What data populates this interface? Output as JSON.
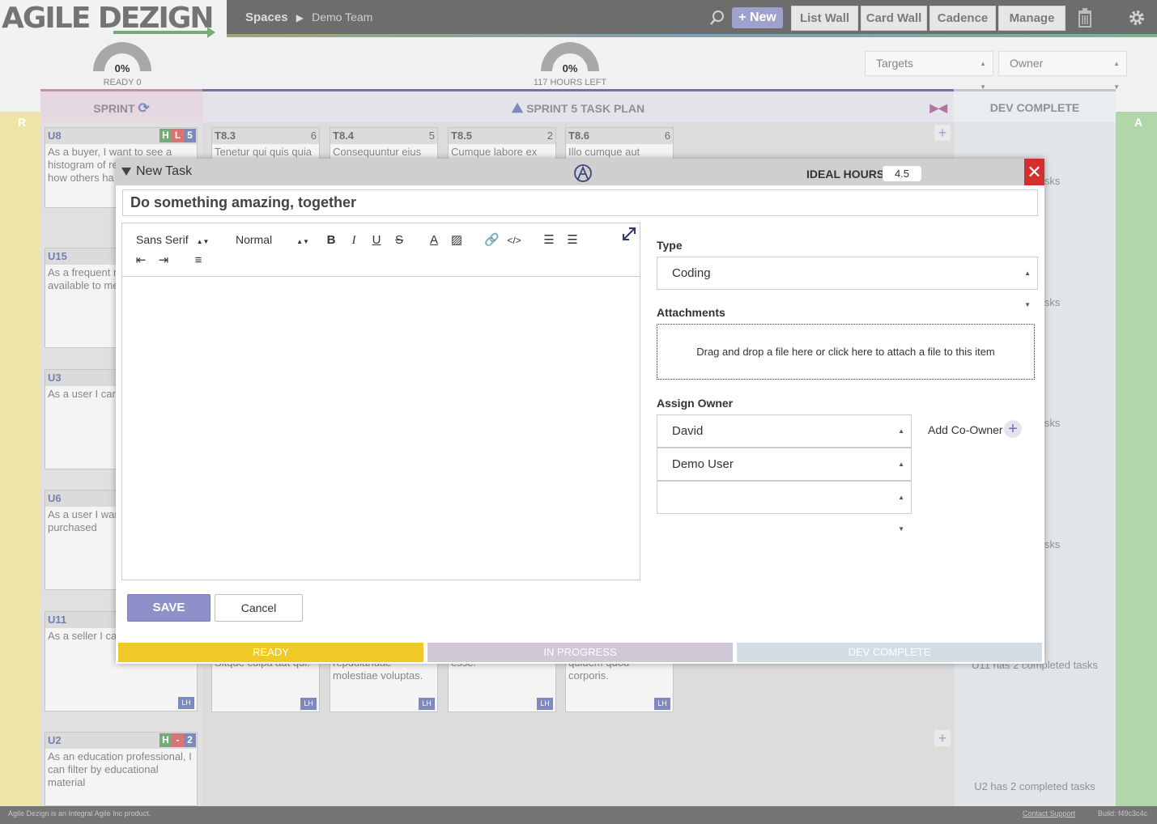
{
  "app": {
    "logo_text": "AGILE DEZIGN",
    "breadcrumb": {
      "root": "Spaces",
      "separator": "▶",
      "current": "Demo Team"
    },
    "new_button": "+ New",
    "nav": [
      "List Wall",
      "Card Wall",
      "Cadence",
      "Manage"
    ]
  },
  "gauges": [
    {
      "pct": "0%",
      "label": "READY 0"
    },
    {
      "pct": "0%",
      "label": "117 HOURS LEFT"
    }
  ],
  "filters": {
    "targets": "Targets",
    "owner": "Owner"
  },
  "columns": {
    "sprint": "SPRINT",
    "task_plan": "SPRINT 5 TASK PLAN",
    "dev_complete": "DEV COMPLETE",
    "left_lane": "R",
    "right_lane": "A"
  },
  "stories": [
    {
      "id": "U8",
      "text": "As a buyer, I want to see a histogram of re and rating so I how others ha am considering",
      "b1": "H",
      "b2": "L",
      "b3": "5"
    },
    {
      "id": "U15",
      "text": "As a frequent my recent sear available to me examples of si"
    },
    {
      "id": "U3",
      "text": "As a user I can results by mult"
    },
    {
      "id": "U6",
      "text": "As a user I wan review for an it purchased"
    },
    {
      "id": "U11",
      "text": "As a seller I ca in bulk"
    },
    {
      "id": "U2",
      "text": "As an education professional, I can filter by educational material",
      "b1": "H",
      "b2": "-",
      "b3": "2"
    }
  ],
  "tasks": [
    {
      "id": "T8.3",
      "hours": "6",
      "text": "Tenetur qui quis quia"
    },
    {
      "id": "T8.4",
      "hours": "5",
      "text": "Consequuntur eius"
    },
    {
      "id": "T8.5",
      "hours": "2",
      "text": "Cumque labore ex"
    },
    {
      "id": "T8.6",
      "hours": "6",
      "text": "Illo cumque aut"
    }
  ],
  "bottom_tasks": [
    "Sitque culpa aut qui.",
    "repudiandae molestiae voluptas.",
    "esse.",
    "quidem quod corporis."
  ],
  "lh": "LH",
  "dev_texts": [
    "pleted tasks",
    "pleted tasks",
    "pleted tasks",
    "pleted tasks",
    "U11 has 2 completed tasks",
    "U2 has 2 completed tasks"
  ],
  "footer": {
    "left": "Agile Dezign is an Integral Agile Inc product.",
    "support": "Contact Support",
    "build": "Build: f49c3c4c"
  },
  "modal": {
    "title": "New Task",
    "ideal_hours_label": "IDEAL HOURS:",
    "ideal_hours": "4.5",
    "task_title": "Do something amazing, together",
    "editor": {
      "font": "Sans Serif",
      "size": "Normal"
    },
    "save": "SAVE",
    "cancel": "Cancel",
    "type_label": "Type",
    "type_value": "Coding",
    "attachments_label": "Attachments",
    "attachments_hint": "Drag and drop a file here or click here to attach a file to this item",
    "owner_label": "Assign Owner",
    "owner": "David",
    "coowner": "Demo User",
    "coowner2": "",
    "add_coowner": "Add Co-Owner",
    "status": [
      "READY",
      "IN PROGRESS",
      "DEV COMPLETE"
    ]
  }
}
